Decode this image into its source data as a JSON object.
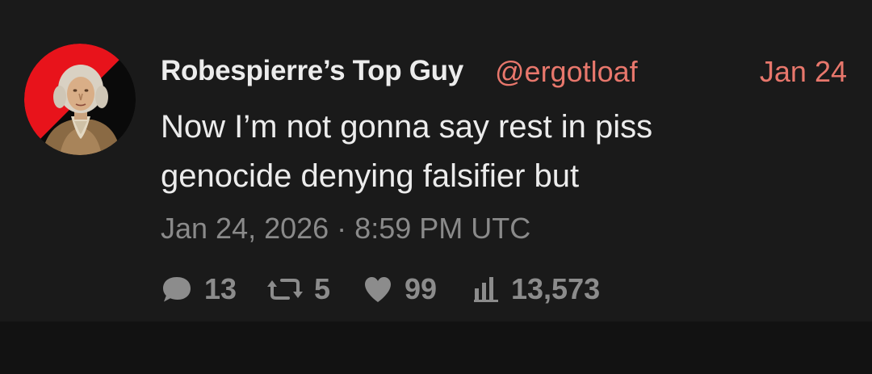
{
  "tweet": {
    "display_name": "Robespierre’s Top Guy",
    "handle": "@ergotloaf",
    "date_short": "Jan 24",
    "body_lines": [
      "Now I’m not gonna say rest in piss",
      "genocide denying falsifier but"
    ],
    "timestamp": "Jan 24, 2026 · 8:59 PM UTC",
    "stats": {
      "replies": "13",
      "retweets": "5",
      "likes": "99",
      "views": "13,573"
    }
  },
  "icons": {
    "reply": "comment-bubble-icon",
    "retweet": "retweet-icon",
    "like": "heart-icon",
    "views": "bar-chart-icon"
  },
  "colors": {
    "background": "#121212",
    "card": "#1a1a1a",
    "accent": "#e8776c",
    "text": "#ececec",
    "muted": "#8a8a8a",
    "avatar_red": "#e8131b",
    "avatar_black": "#0a0a0a"
  }
}
